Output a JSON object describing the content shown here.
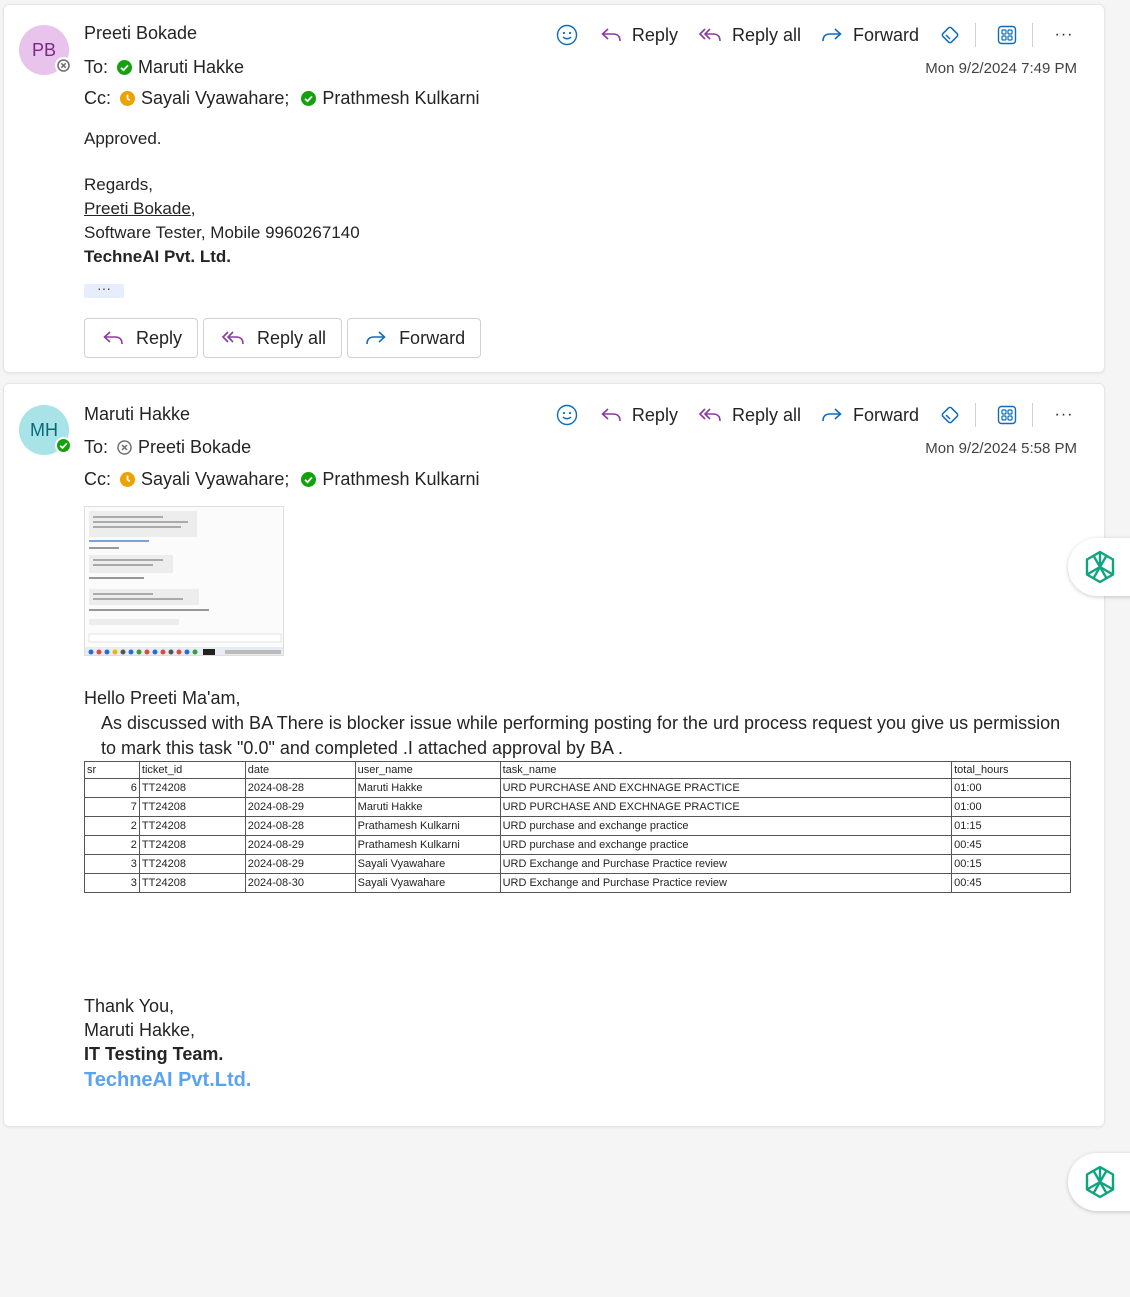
{
  "toolbar": {
    "reply": "Reply",
    "reply_all": "Reply all",
    "forward": "Forward",
    "more": "···"
  },
  "emails": [
    {
      "initials": "PB",
      "sender": "Preeti Bokade",
      "to_label": "To:",
      "to": "Maruti Hakke",
      "cc_label": "Cc:",
      "cc": [
        "Sayali Vyawahare;",
        "Prathmesh Kulkarni"
      ],
      "date": "Mon 9/2/2024 7:49 PM",
      "body": {
        "line1": "Approved.",
        "regards": "Regards,",
        "name": "Preeti Bokade",
        "name_suffix": ",",
        "role": "Software Tester, Mobile 9960267140",
        "company": "TechneAI Pvt. Ltd."
      },
      "expand": "···"
    },
    {
      "initials": "MH",
      "sender": "Maruti Hakke",
      "to_label": "To:",
      "to": "Preeti Bokade",
      "cc_label": "Cc:",
      "cc": [
        "Sayali Vyawahare;",
        "Prathmesh Kulkarni"
      ],
      "date": "Mon 9/2/2024 5:58 PM",
      "body": {
        "greeting": "Hello Preeti  Ma'am,",
        "para": "As discussed with BA There is blocker issue while performing posting for the urd process request you give us permission to mark this task \"0.0\" and completed .I attached approval by BA ."
      },
      "table": {
        "headers": [
          "sr",
          "ticket_id",
          "date",
          "user_name",
          "task_name",
          "total_hours"
        ],
        "rows": [
          [
            "6",
            "TT24208",
            "2024-08-28",
            "Maruti Hakke",
            "URD PURCHASE AND EXCHNAGE PRACTICE",
            "01:00"
          ],
          [
            "7",
            "TT24208",
            "2024-08-29",
            "Maruti Hakke",
            "URD PURCHASE AND EXCHNAGE PRACTICE",
            "01:00"
          ],
          [
            "2",
            "TT24208",
            "2024-08-28",
            "Prathamesh Kulkarni",
            "URD purchase and exchange practice",
            "01:15"
          ],
          [
            "2",
            "TT24208",
            "2024-08-29",
            "Prathamesh Kulkarni",
            "URD purchase and exchange practice",
            "00:45"
          ],
          [
            "3",
            "TT24208",
            "2024-08-29",
            "Sayali Vyawahare",
            "URD Exchange and Purchase Practice review",
            "00:15"
          ],
          [
            "3",
            "TT24208",
            "2024-08-30",
            "Sayali Vyawahare",
            "URD Exchange and Purchase Practice review",
            "00:45"
          ]
        ]
      },
      "signature": {
        "thanks": "Thank You,",
        "name": "Maruti Hakke,",
        "team": "IT Testing Team.",
        "company": "TechneAI Pvt.Ltd."
      }
    }
  ],
  "colors": {
    "accent": "#0f6cbd",
    "purple_icon": "#8b3aa0",
    "online": "#13a10e",
    "away": "#eaa300",
    "brand_link": "#5aa4ef"
  }
}
